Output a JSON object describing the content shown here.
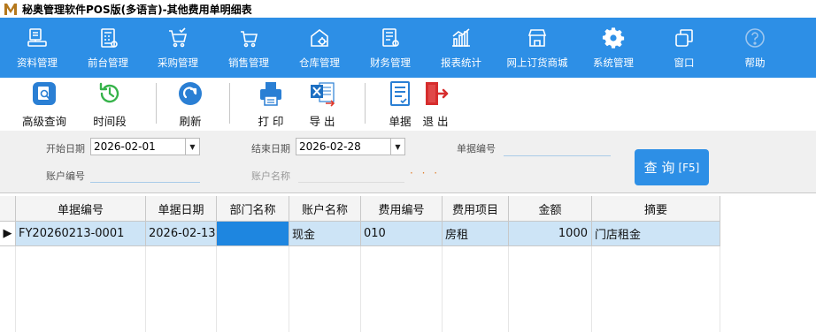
{
  "window": {
    "title": "秘奥管理软件POS版(多语言)-其他费用单明细表",
    "logo_text": "M"
  },
  "colors": {
    "accent": "#2d8fe6",
    "selected_row": "#cde4f6",
    "selected_cell": "#1e86e0"
  },
  "menu": {
    "items": [
      {
        "label": "资料管理",
        "icon": "document-stamp-icon"
      },
      {
        "label": "前台管理",
        "icon": "pos-register-icon"
      },
      {
        "label": "采购管理",
        "icon": "shopping-cart-check-icon"
      },
      {
        "label": "销售管理",
        "icon": "cart-icon"
      },
      {
        "label": "仓库管理",
        "icon": "warehouse-gear-icon"
      },
      {
        "label": "财务管理",
        "icon": "ledger-icon"
      },
      {
        "label": "报表统计",
        "icon": "bar-chart-icon"
      },
      {
        "label": "网上订货商城",
        "icon": "storefront-icon"
      },
      {
        "label": "系统管理",
        "icon": "gear-icon"
      },
      {
        "label": "窗口",
        "icon": "windows-icon"
      },
      {
        "label": "帮助",
        "icon": "help-icon"
      }
    ]
  },
  "toolbar": {
    "advanced_query": "高级查询",
    "time_range": "时间段",
    "refresh": "刷新",
    "print": "打 印",
    "export": "导 出",
    "document": "单据",
    "exit": "退 出"
  },
  "filter": {
    "start_date_label": "开始日期",
    "start_date_value": "2026-02-01",
    "end_date_label": "结束日期",
    "end_date_value": "2026-02-28",
    "doc_no_label": "单据编号",
    "doc_no_value": "",
    "account_no_label": "账户编号",
    "account_no_value": "",
    "account_name_label": "账户名称",
    "account_name_value": "",
    "lookup_dots": "· · ·",
    "query_button": "查 询",
    "query_shortcut": "[F5]"
  },
  "grid": {
    "columns": [
      "单据编号",
      "单据日期",
      "部门名称",
      "账户名称",
      "费用编号",
      "费用项目",
      "金额",
      "摘要"
    ],
    "rows": [
      {
        "indicator": "▶",
        "doc_no": "FY20260213-0001",
        "doc_date": "2026-02-13",
        "dept_name": "",
        "account_name": "现金",
        "fee_code": "010",
        "fee_item": "房租",
        "amount": "1000",
        "summary": "门店租金"
      }
    ]
  }
}
